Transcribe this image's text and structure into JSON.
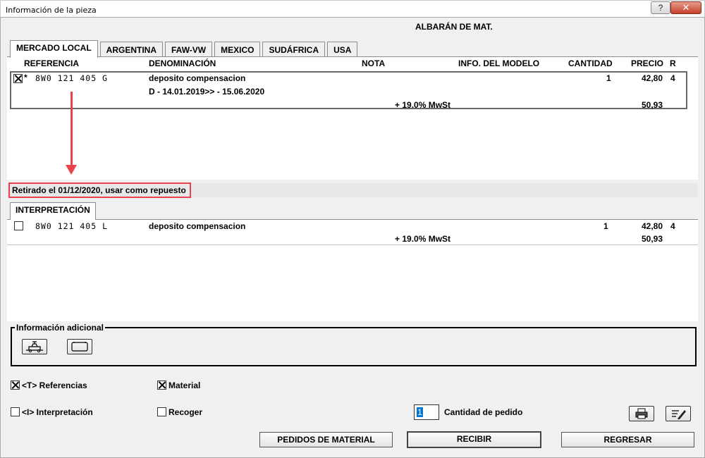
{
  "window": {
    "title": "Información de la pieza",
    "help_btn": "?",
    "close_btn": "✕"
  },
  "header": {
    "title": "ALBARÁN DE MAT."
  },
  "tabs": [
    "MERCADO LOCAL",
    "ARGENTINA",
    "FAW-VW",
    "MEXICO",
    "SUDÁFRICA",
    "USA"
  ],
  "columns": {
    "referencia": "REFERENCIA",
    "denominacion": "DENOMINACIÓN",
    "nota": "NOTA",
    "info_modelo": "INFO. DEL MODELO",
    "cantidad": "CANTIDAD",
    "precio": "PRECIO",
    "r": "R"
  },
  "top_row": {
    "marker": "*",
    "reference": "8W0 121 405 G",
    "description": "deposito compensacion",
    "validity": "D - 14.01.2019>> - 15.06.2020",
    "quantity": "1",
    "price": "42,80",
    "r": "4",
    "tax_label": "+ 19.0% MwSt",
    "price_with_tax": "50,93"
  },
  "status": {
    "text": "Retirado el 01/12/2020, usar como repuesto"
  },
  "interpretation": {
    "tab": "INTERPRETACIÓN",
    "row": {
      "reference": "8W0 121 405 L",
      "description": "deposito compensacion",
      "quantity": "1",
      "price": "42,80",
      "r": "4",
      "tax_label": "+ 19.0% MwSt",
      "price_with_tax": "50,93"
    }
  },
  "additional_info": {
    "legend": "Información adicional"
  },
  "options": {
    "referencias": {
      "label": "<T> Referencias",
      "checked": true
    },
    "material": {
      "label": "Material",
      "checked": true
    },
    "interpretacion": {
      "label": "<I> Interpretación",
      "checked": false
    },
    "recoger": {
      "label": "Recoger",
      "checked": false
    }
  },
  "quantity": {
    "value": "1",
    "label": "Cantidad de pedido"
  },
  "buttons": {
    "pedidos": "PEDIDOS DE MATERIAL",
    "recibir": "RECIBIR",
    "regresar": "REGRESAR"
  }
}
